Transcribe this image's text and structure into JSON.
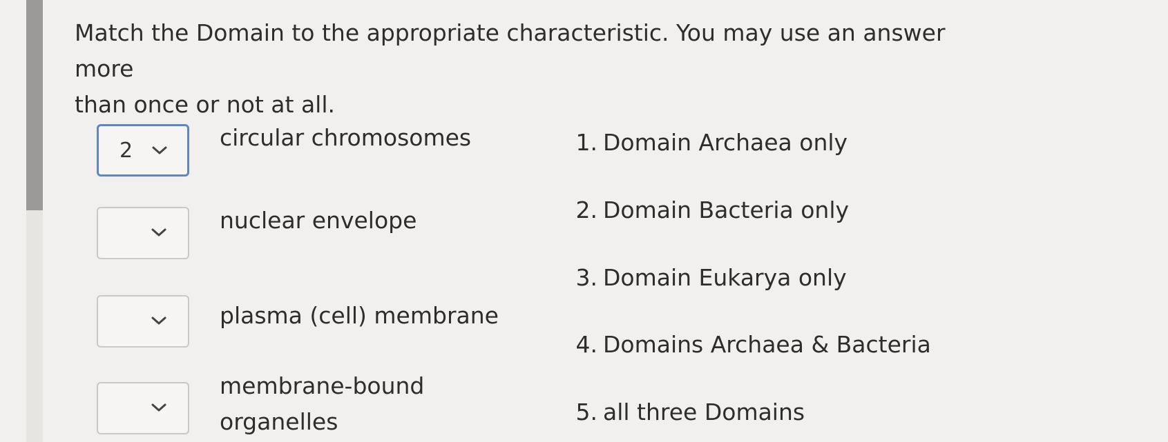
{
  "question": {
    "line1": "Match the Domain to the appropriate characteristic. You may use an answer more",
    "line2": "than once or not at all."
  },
  "matches": [
    {
      "selected": "2",
      "label": "circular chromosomes"
    },
    {
      "selected": "",
      "label": "nuclear envelope"
    },
    {
      "selected": "",
      "label": "plasma (cell) membrane"
    },
    {
      "selected": "",
      "label_line1": "membrane-bound",
      "label_line2": "organelles"
    }
  ],
  "answers": [
    {
      "num": "1.",
      "text": "Domain Archaea only"
    },
    {
      "num": "2.",
      "text": "Domain Bacteria only"
    },
    {
      "num": "3.",
      "text": "Domain Eukarya only"
    },
    {
      "num": "4.",
      "text": "Domains Archaea & Bacteria"
    },
    {
      "num": "5.",
      "text": "all three Domains"
    }
  ],
  "colors": {
    "selected_border": "#5f86bd",
    "background": "#f1f0ee",
    "scroll_thumb": "#9b9a98"
  },
  "icons": {
    "dropdown": "chevron-down-icon"
  }
}
